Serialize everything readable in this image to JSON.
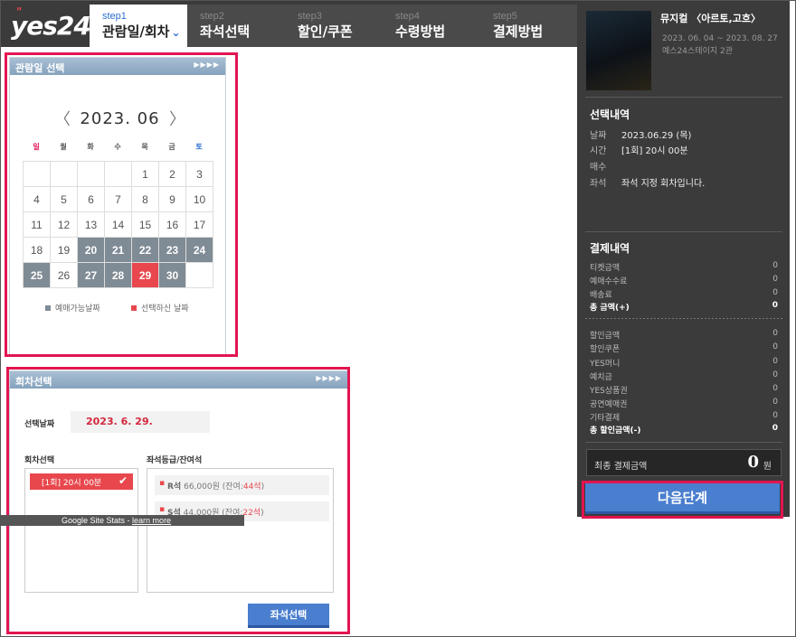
{
  "header": {
    "logo": "yes24",
    "steps": [
      {
        "num": "step1",
        "name": "관람일/회차"
      },
      {
        "num": "step2",
        "name": "좌석선택"
      },
      {
        "num": "step3",
        "name": "할인/쿠폰"
      },
      {
        "num": "step4",
        "name": "수령방법"
      },
      {
        "num": "step5",
        "name": "결제방법"
      }
    ]
  },
  "sidebar": {
    "title": "뮤지컬 〈아르토,고흐〉",
    "period": "2023. 06. 04 ~ 2023. 08. 27",
    "venue": "예스24스테이지 2관",
    "selection_title": "선택내역",
    "selection": [
      {
        "k": "날짜",
        "v": "2023.06.29 (목)"
      },
      {
        "k": "시간",
        "v": "[1회] 20시 00분"
      },
      {
        "k": "매수",
        "v": ""
      },
      {
        "k": "좌석",
        "v": "좌석 지정 회차입니다."
      }
    ],
    "payment_title": "결제내역",
    "payment_rows": [
      {
        "k": "티켓금액",
        "v": "0"
      },
      {
        "k": "예매수수료",
        "v": "0"
      },
      {
        "k": "배송료",
        "v": "0"
      },
      {
        "k": "총 금액(+)",
        "v": "0"
      }
    ],
    "discount_rows": [
      {
        "k": "할인금액",
        "v": "0"
      },
      {
        "k": "할인쿠폰",
        "v": "0"
      },
      {
        "k": "YES머니",
        "v": "0"
      },
      {
        "k": "예치금",
        "v": "0"
      },
      {
        "k": "YES상품권",
        "v": "0"
      },
      {
        "k": "공연예매권",
        "v": "0"
      },
      {
        "k": "기타결제",
        "v": "0"
      },
      {
        "k": "총 할인금액(-)",
        "v": "0"
      }
    ],
    "final_label": "최종 결제금액",
    "final_value": "0",
    "final_unit": "원",
    "next_button": "다음단계"
  },
  "calendar": {
    "panel_title": "관람일 선택",
    "arrows": "▶▶▶▶",
    "month": "2023. 06",
    "weekdays": [
      "일",
      "월",
      "화",
      "수",
      "목",
      "금",
      "토"
    ],
    "weeks": [
      [
        "",
        "",
        "",
        "",
        "1",
        "2",
        "3"
      ],
      [
        "4",
        "5",
        "6",
        "7",
        "8",
        "9",
        "10"
      ],
      [
        "11",
        "12",
        "13",
        "14",
        "15",
        "16",
        "17"
      ],
      [
        "18",
        "19",
        "20",
        "21",
        "22",
        "23",
        "24"
      ],
      [
        "25",
        "26",
        "27",
        "28",
        "29",
        "30",
        ""
      ]
    ],
    "available_days": [
      "20",
      "21",
      "22",
      "23",
      "24",
      "25",
      "27",
      "28",
      "30"
    ],
    "selected_day": "29",
    "legend_available": "예매가능날짜",
    "legend_selected": "선택하신 날짜",
    "available_color": "#7f8b95",
    "selected_color": "#e8474d"
  },
  "round": {
    "panel_title": "회차선택",
    "arrows": "▶▶▶▶",
    "date_label": "선택날짜",
    "date_value": "2023. 6. 29.",
    "round_label": "회차선택",
    "seat_label": "좌석등급/잔여석",
    "round_item": "[1회] 20시 00분",
    "seats": [
      {
        "grade": "R석",
        "price": "66,000원 (잔여:",
        "remain": "44석",
        "close": ")"
      },
      {
        "grade": "S석",
        "price": "44,000원 (잔여:",
        "remain": "22석",
        "close": ")"
      }
    ],
    "seat_button": "좌석선택"
  },
  "overlay": {
    "stats_text": "Google Site Stats - ",
    "stats_link": "learn more"
  }
}
